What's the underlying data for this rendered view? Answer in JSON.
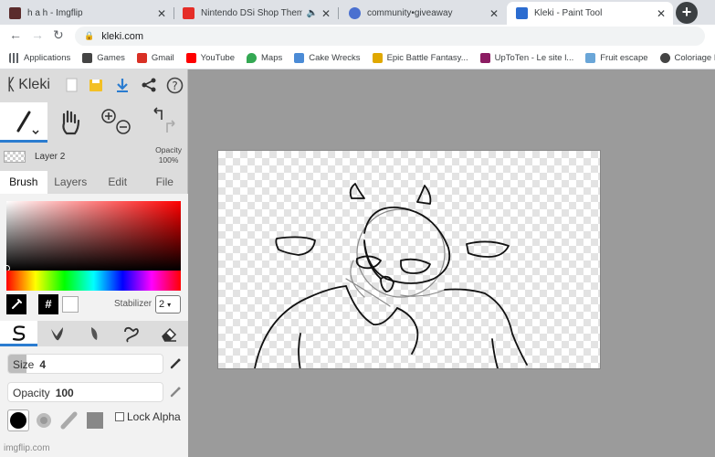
{
  "browser": {
    "tabs": [
      {
        "title": "h a h - Imgflip",
        "favicon_color": "#5b2c2c",
        "active": false
      },
      {
        "title": "Nintendo DSi Shop Theme (F",
        "favicon_color": "#e52d27",
        "active": false,
        "audio": "🔈"
      },
      {
        "title": "community•giveaway",
        "favicon_color": "#4a70d0",
        "active": false
      },
      {
        "title": "Kleki - Paint Tool",
        "favicon_color": "#2b6cd0",
        "active": true
      }
    ],
    "close_glyph": "✕",
    "new_tab": "+",
    "nav": {
      "back": "←",
      "forward": "→",
      "reload": "↻"
    },
    "url": "kleki.com",
    "bookmarks": [
      {
        "label": "Applications",
        "color": "#5f6368"
      },
      {
        "label": "Games",
        "color": "#444444"
      },
      {
        "label": "Gmail",
        "color": "#d93025"
      },
      {
        "label": "YouTube",
        "color": "#ff0000"
      },
      {
        "label": "Maps",
        "color": "#34a853"
      },
      {
        "label": "Cake Wrecks",
        "color": "#4b8bd6"
      },
      {
        "label": "Epic Battle Fantasy...",
        "color": "#e0a800"
      },
      {
        "label": "UpToTen - Le site l...",
        "color": "#8b1c62"
      },
      {
        "label": "Fruit escape",
        "color": "#6aa6d8"
      },
      {
        "label": "Coloriage Pa",
        "color": "#444444"
      }
    ]
  },
  "kleki": {
    "logo": "Kleki",
    "layer": {
      "name": "Layer 2",
      "opacity_label": "Opacity",
      "opacity_value": "100%"
    },
    "tabs": [
      "Brush",
      "Layers",
      "Edit",
      "File"
    ],
    "active_tab": "Brush",
    "color": {
      "hex_symbol": "#",
      "current": "#ffffff",
      "stabilizer_label": "Stabilizer",
      "stabilizer_value": "2"
    },
    "brush": {
      "size_label": "Size",
      "size_value": "4",
      "size_fraction": 0.12,
      "opacity_label": "Opacity",
      "opacity_value": "100",
      "opacity_fraction": 0.0
    },
    "lock_alpha": "Lock Alpha"
  },
  "watermark": "imgflip.com",
  "colors": {
    "accent": "#2a7cd0",
    "sidebar": "#dcdcdc",
    "workspace": "#9b9b9b"
  }
}
